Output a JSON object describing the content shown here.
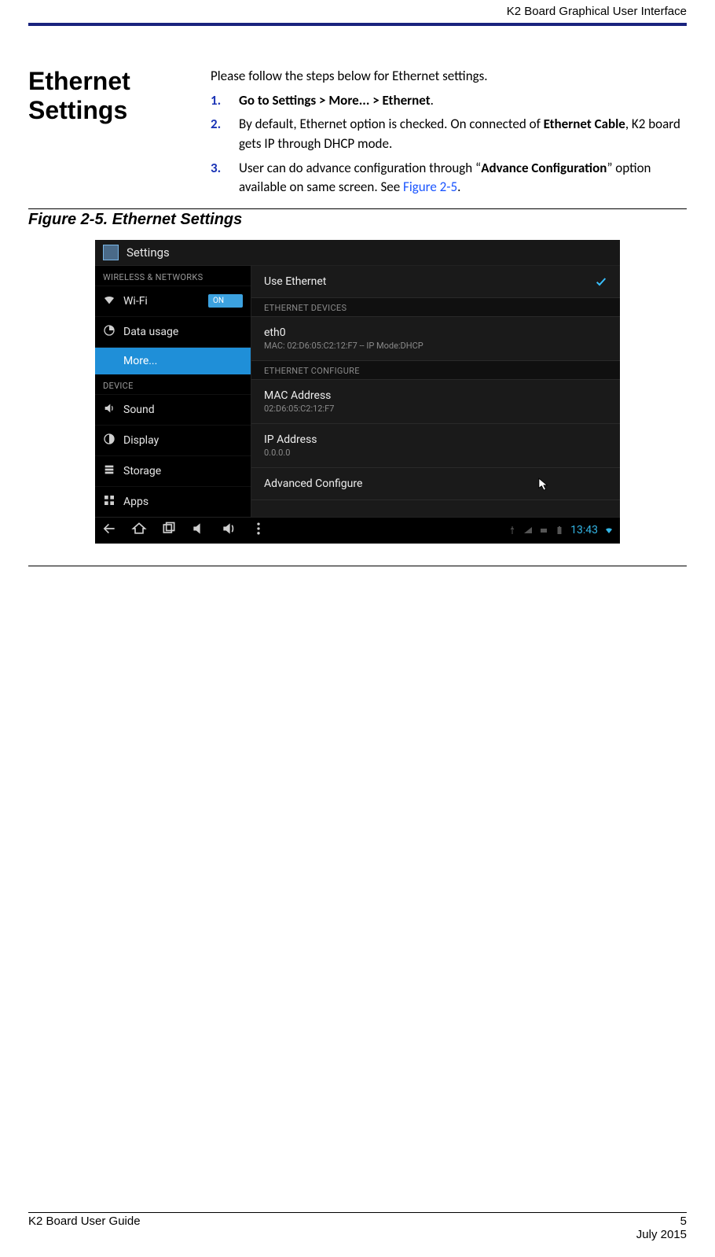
{
  "running_header": "K2 Board Graphical User Interface",
  "section_title_line1": "Ethernet",
  "section_title_line2": "Settings",
  "intro": "Please follow the steps below for Ethernet settings.",
  "steps": [
    {
      "num": "1.",
      "b1": "Go to Settings > More... > Ethernet",
      "tail": "."
    },
    {
      "num": "2.",
      "pre": "By default, Ethernet option is checked. On connected of ",
      "b1": "Ethernet Cable",
      "tail": ", K2 board gets IP through DHCP mode."
    },
    {
      "num": "3.",
      "pre": "User can do advance configuration through “",
      "b1": "Advance Configuration",
      "tail": "” option available on same screen. See ",
      "fig": "Figure 2-5",
      "after_fig": "."
    }
  ],
  "figure_caption": "Figure 2-5. Ethernet Settings",
  "android": {
    "app_title": "Settings",
    "sidebar": {
      "sect1": "WIRELESS & NETWORKS",
      "wifi": "Wi-Fi",
      "wifi_toggle": "ON",
      "data_usage": "Data usage",
      "more": "More...",
      "sect2": "DEVICE",
      "sound": "Sound",
      "display": "Display",
      "storage": "Storage",
      "apps": "Apps"
    },
    "content": {
      "use_ethernet": "Use Ethernet",
      "sect_devices": "ETHERNET DEVICES",
      "eth0": "eth0",
      "eth0_sub": "MAC: 02:D6:05:C2:12:F7 -- IP Mode:DHCP",
      "sect_configure": "ETHERNET CONFIGURE",
      "mac_label": "MAC Address",
      "mac_value": "02:D6:05:C2:12:F7",
      "ip_label": "IP Address",
      "ip_value": "0.0.0.0",
      "advanced": "Advanced Configure"
    },
    "clock": "13:43"
  },
  "footer": {
    "left": "K2 Board User Guide",
    "page": "5",
    "date": "July 2015"
  }
}
